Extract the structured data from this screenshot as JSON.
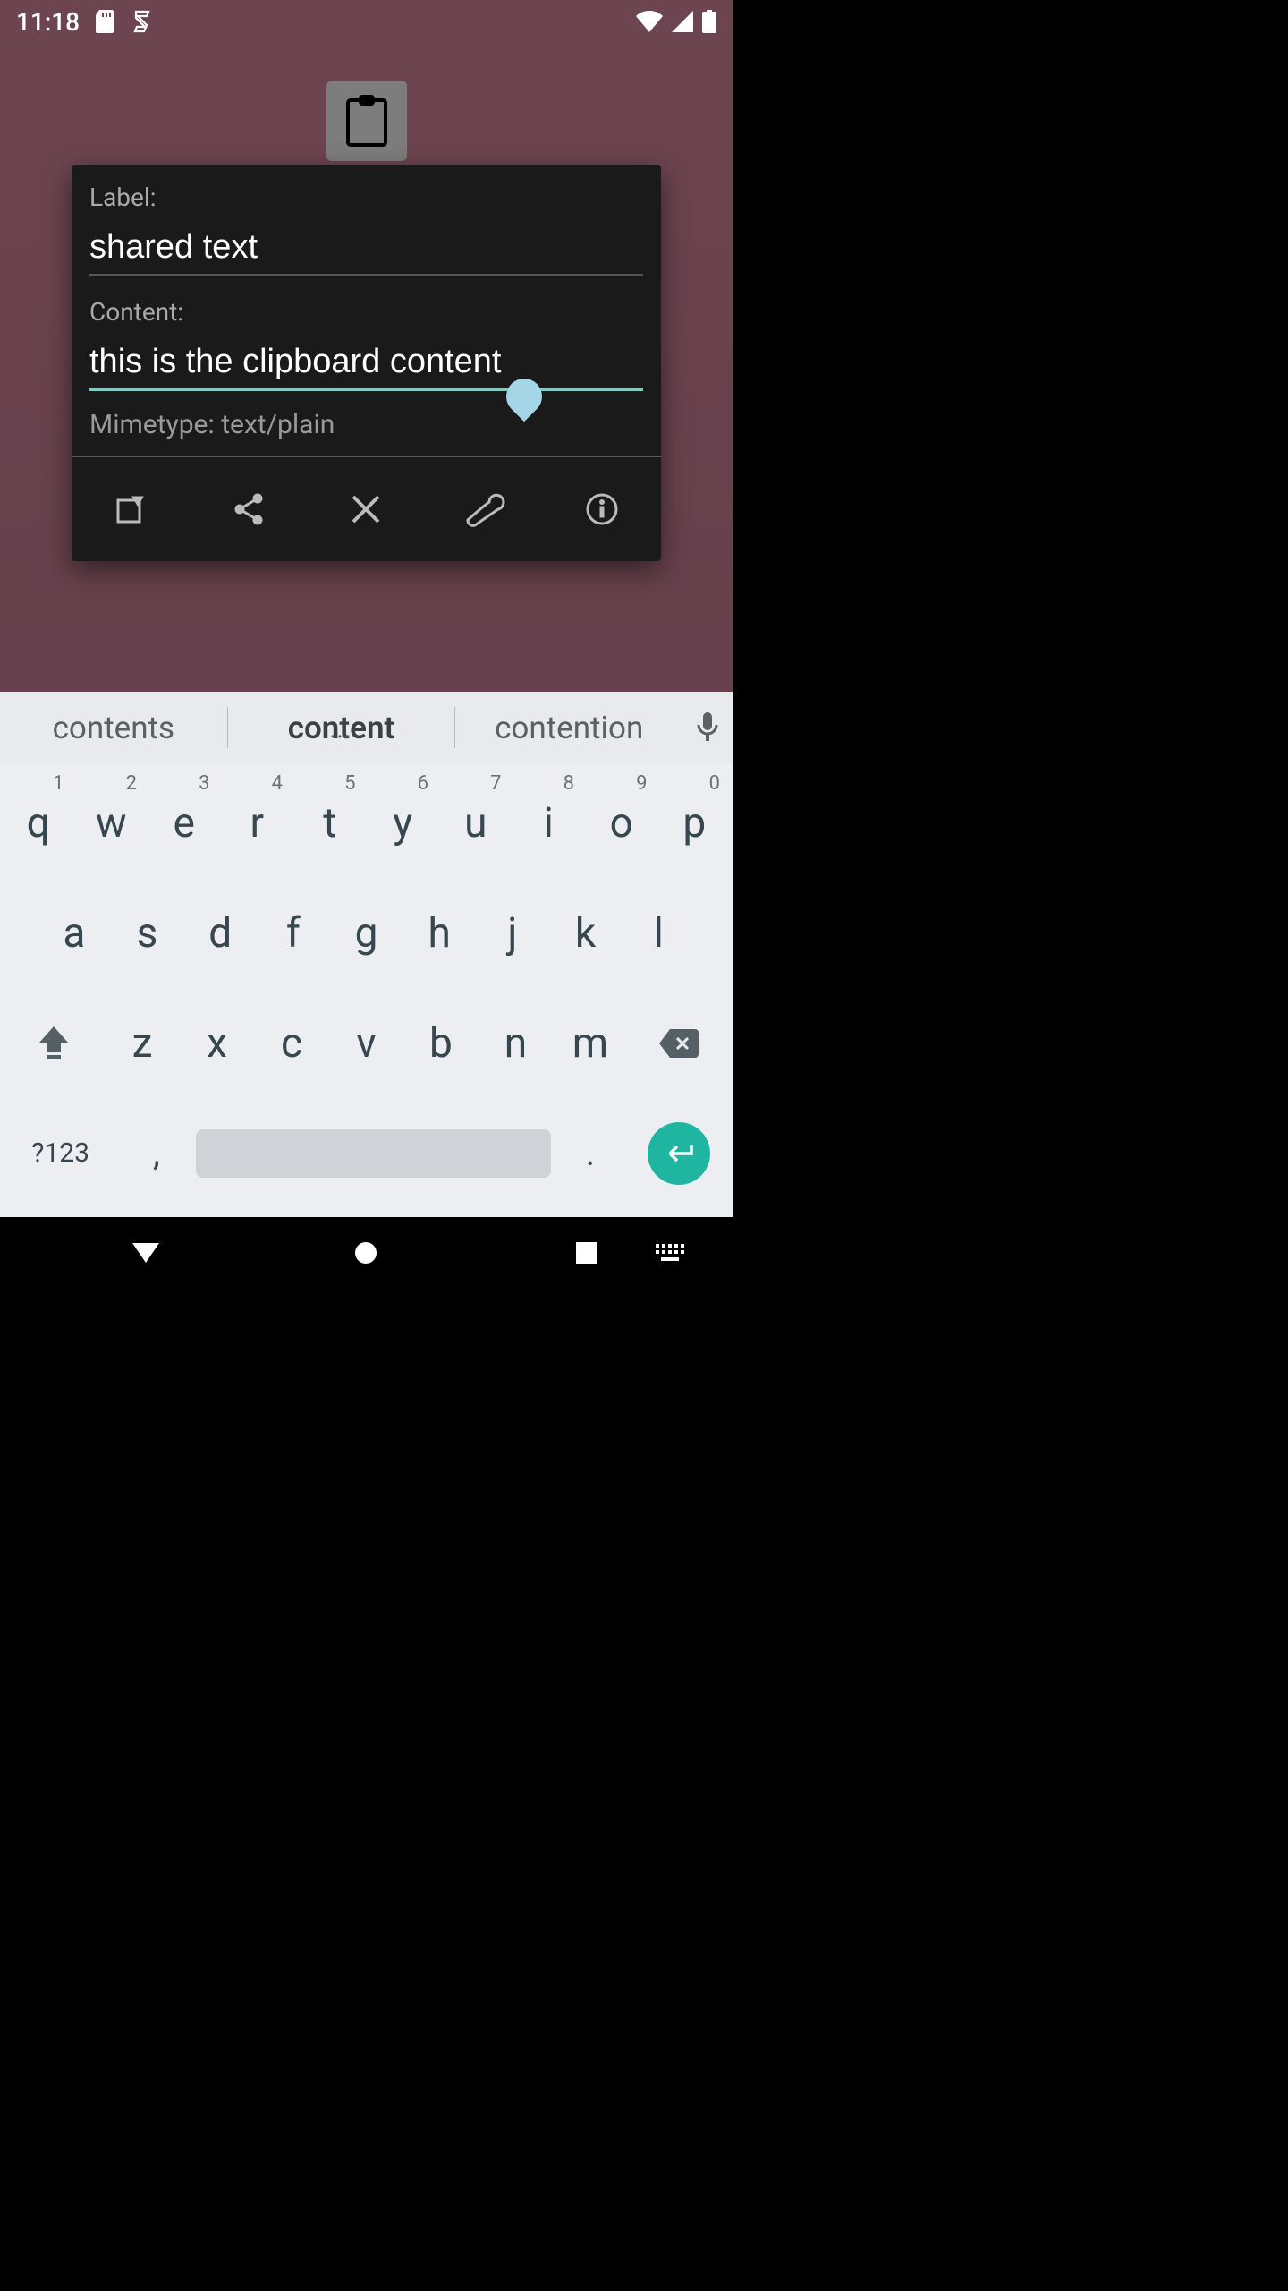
{
  "status": {
    "time": "11:18",
    "icons_left": [
      "sd-card-icon",
      "app-status-icon"
    ],
    "icons_right": [
      "wifi-icon",
      "cell-signal-icon",
      "battery-icon"
    ]
  },
  "dialog": {
    "label_caption": "Label:",
    "label_value": "shared text",
    "content_caption": "Content:",
    "content_value": "this is the clipboard content",
    "mimetype_caption": "Mimetype:",
    "mimetype_value": "text/plain",
    "actions": [
      "export",
      "share",
      "close",
      "settings",
      "info"
    ]
  },
  "keyboard": {
    "suggestions": [
      "contents",
      "content",
      "contention"
    ],
    "row1": [
      {
        "k": "q",
        "h": "1"
      },
      {
        "k": "w",
        "h": "2"
      },
      {
        "k": "e",
        "h": "3"
      },
      {
        "k": "r",
        "h": "4"
      },
      {
        "k": "t",
        "h": "5"
      },
      {
        "k": "y",
        "h": "6"
      },
      {
        "k": "u",
        "h": "7"
      },
      {
        "k": "i",
        "h": "8"
      },
      {
        "k": "o",
        "h": "9"
      },
      {
        "k": "p",
        "h": "0"
      }
    ],
    "row2": [
      "a",
      "s",
      "d",
      "f",
      "g",
      "h",
      "j",
      "k",
      "l"
    ],
    "row3": [
      "z",
      "x",
      "c",
      "v",
      "b",
      "n",
      "m"
    ],
    "sym_label": "?123",
    "comma": ",",
    "period": "."
  },
  "colors": {
    "accent": "#7fcac3",
    "enter": "#1fb6a1"
  }
}
